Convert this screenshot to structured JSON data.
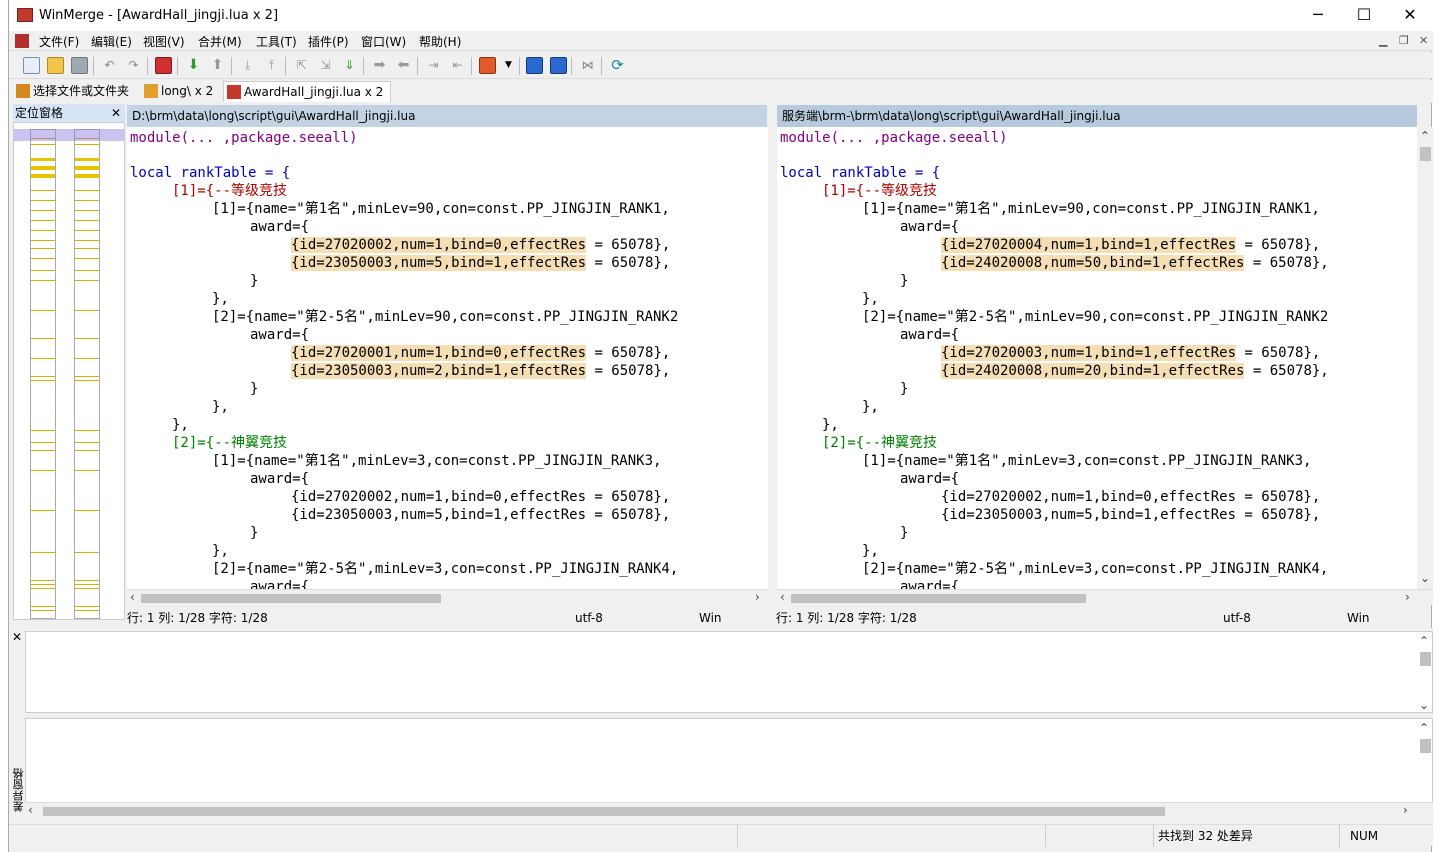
{
  "window": {
    "title": "WinMerge - [AwardHall_jingji.lua x 2]",
    "min": "─",
    "max": "☐",
    "close": "✕"
  },
  "menu": [
    "文件(F)",
    "编辑(E)",
    "视图(V)",
    "合并(M)",
    "工具(T)",
    "插件(P)",
    "窗口(W)",
    "帮助(H)"
  ],
  "mdi_controls": [
    "▁",
    "❐",
    "✕"
  ],
  "tabs": [
    "选择文件或文件夹",
    "long\\ x 2",
    "AwardHall_jingji.lua x 2"
  ],
  "location_pane": {
    "title": "定位窗格",
    "close": "✕"
  },
  "left": {
    "path": "D:\\brm\\data\\long\\script\\gui\\AwardHall_jingji.lua",
    "status": {
      "pos": "行: 1  列: 1/28  字符: 1/28",
      "encoding": "utf-8",
      "eol": "Win"
    }
  },
  "right": {
    "path": "服务端\\brm-\\brm\\data\\long\\script\\gui\\AwardHall_jingji.lua",
    "status": {
      "pos": "行: 1  列: 1/28  字符: 1/28",
      "encoding": "utf-8",
      "eol": "Win"
    }
  },
  "code_common": {
    "l1": "module(... ,package.seeall)",
    "l2": "local rankTable = {",
    "l3": "[1]={--等级竞技",
    "l4": "[1]={name=\"第1名\",minLev=90,con=const.PP_JINGJIN_RANK1,",
    "l5": "award={",
    "l8": "}",
    "l9": "},",
    "l10": "[2]={name=\"第2-5名\",minLev=90,con=const.PP_JINGJIN_RANK2",
    "l16": "},",
    "l17": "[2]={--神翼竞技",
    "l18": "[1]={name=\"第1名\",minLev=3,con=const.PP_JINGJIN_RANK3,",
    "l20": "{id=27020002,num=1,bind=0,effectRes = 65078},",
    "l21": "{id=23050003,num=5,bind=1,effectRes = 65078},",
    "l24": "[2]={name=\"第2-5名\",minLev=3,con=const.PP_JINGJIN_RANK4,"
  },
  "left_diff": [
    {
      "a": "{id=27020002,num=1,bind=0,effectRes",
      "b": " = 65078},"
    },
    {
      "a": "{id=23050003,num=5,bind=1,effectRes",
      "b": " = 65078},"
    },
    {
      "a": "{id=27020001,num=1,bind=0,effectRes",
      "b": " = 65078},"
    },
    {
      "a": "{id=23050003,num=2,bind=1,effectRes",
      "b": " = 65078},"
    }
  ],
  "right_diff": [
    {
      "a": "{id=27020004,num=1,bind=1,effectRes",
      "b": " = 65078},"
    },
    {
      "a": "{id=24020008,num=50,bind=1,effectRes",
      "b": " = 65078},"
    },
    {
      "a": "{id=27020003,num=1,bind=1,effectRes",
      "b": " = 65078},"
    },
    {
      "a": "{id=24020008,num=20,bind=1,effectRes",
      "b": " = 65078},"
    }
  ],
  "diff_pane": {
    "label": "差异窗格",
    "close": "✕"
  },
  "statusbar": {
    "diffs": "共找到 32 处差异",
    "num": "NUM"
  },
  "colors": {
    "diff": "#eec900",
    "diff_text": "#f5deb3",
    "header_left": "#c3d3e3",
    "header_right": "#b7c9dc",
    "location_view": "#8c78dc"
  }
}
